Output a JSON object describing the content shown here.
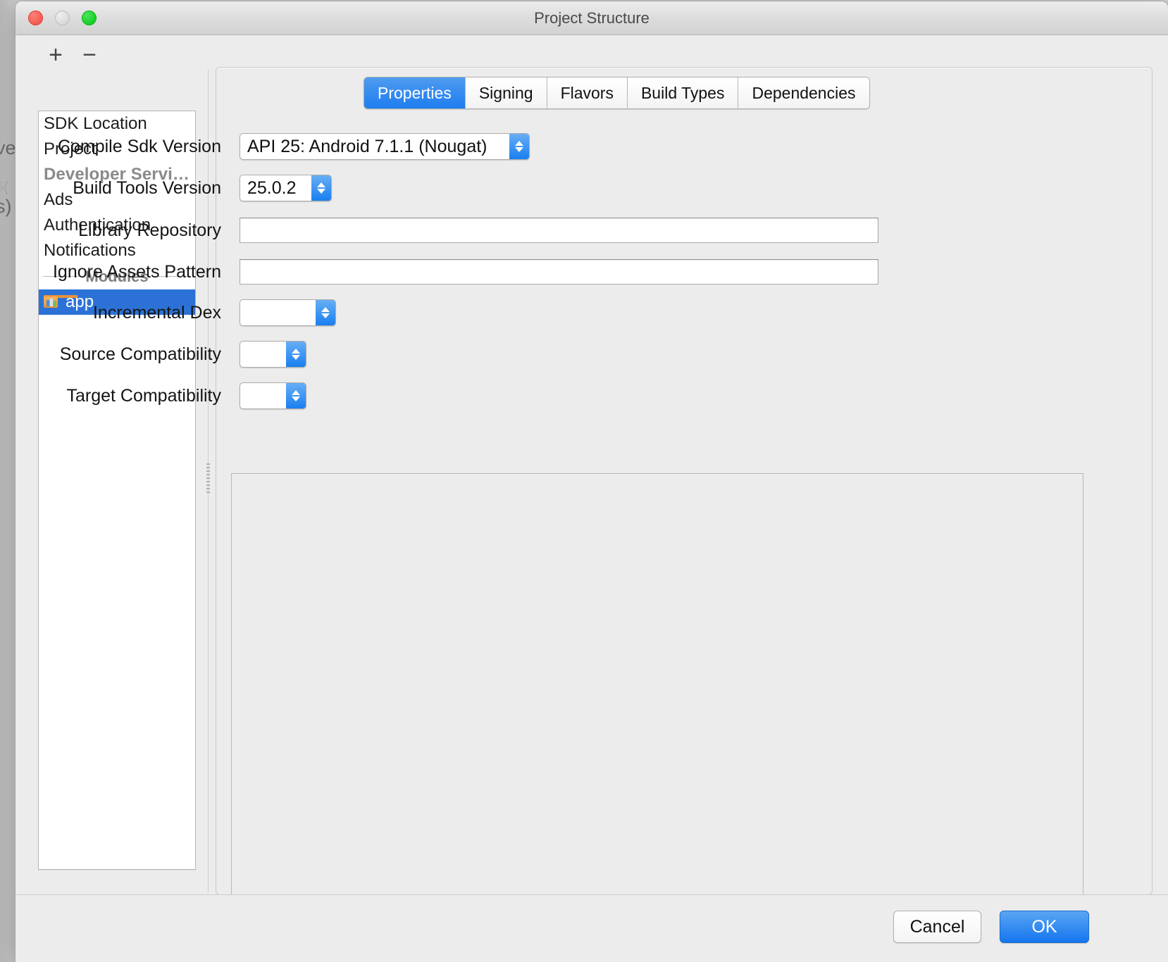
{
  "desktop": {
    "background_fragments": [
      "ve",
      "5(",
      "s)"
    ]
  },
  "window": {
    "title": "Project Structure",
    "traffic_lights": {
      "close": "close-button",
      "minimize": "minimize-button",
      "zoom": "zoom-button"
    }
  },
  "sidebar": {
    "toolbar": {
      "add_label": "+",
      "remove_label": "−"
    },
    "items": [
      {
        "label": "SDK Location",
        "type": "item",
        "selected": false
      },
      {
        "label": "Project",
        "type": "item",
        "selected": false
      },
      {
        "label": "Developer Servi…",
        "type": "group",
        "selected": false
      },
      {
        "label": "Ads",
        "type": "item",
        "selected": false
      },
      {
        "label": "Authentication",
        "type": "item",
        "selected": false
      },
      {
        "label": "Notifications",
        "type": "item",
        "selected": false
      }
    ],
    "separator_label": "Modules",
    "modules": [
      {
        "label": "app",
        "selected": true,
        "icon": "android-module-icon"
      }
    ]
  },
  "tabs": [
    {
      "label": "Properties",
      "active": true
    },
    {
      "label": "Signing",
      "active": false
    },
    {
      "label": "Flavors",
      "active": false
    },
    {
      "label": "Build Types",
      "active": false
    },
    {
      "label": "Dependencies",
      "active": false
    }
  ],
  "form": {
    "compile_sdk_version": {
      "label": "Compile Sdk Version",
      "value": "API 25: Android 7.1.1 (Nougat)"
    },
    "build_tools_version": {
      "label": "Build Tools Version",
      "value": "25.0.2"
    },
    "library_repository": {
      "label": "Library Repository",
      "value": ""
    },
    "ignore_assets_pattern": {
      "label": "Ignore Assets Pattern",
      "value": ""
    },
    "incremental_dex": {
      "label": "Incremental Dex",
      "value": ""
    },
    "source_compatibility": {
      "label": "Source Compatibility",
      "value": ""
    },
    "target_compatibility": {
      "label": "Target Compatibility",
      "value": ""
    }
  },
  "footer": {
    "cancel_label": "Cancel",
    "ok_label": "OK"
  },
  "colors": {
    "accent_blue": "#1e7df0",
    "selection_blue": "#2c72d6",
    "window_bg": "#ececec",
    "ok_blue": "#1576ef"
  }
}
